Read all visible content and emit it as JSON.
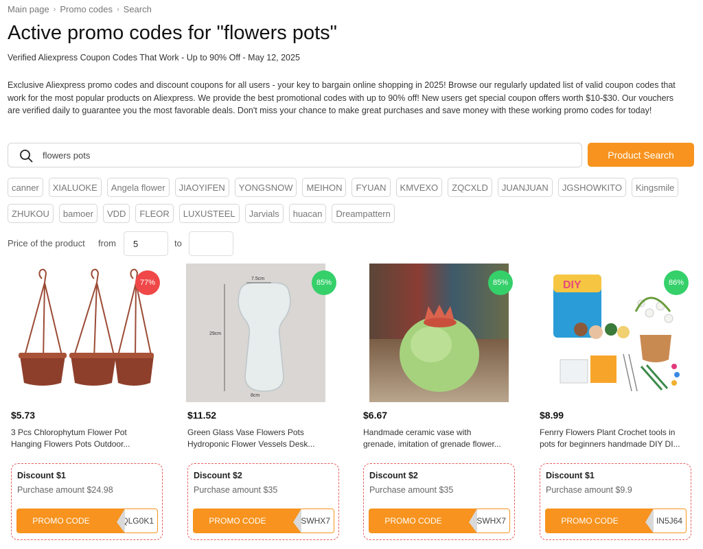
{
  "breadcrumb": [
    "Main page",
    "Promo codes",
    "Search"
  ],
  "title": "Active promo codes for \"flowers pots\"",
  "subtitle": "Verified Aliexpress Coupon Codes That Work - Up to 90% Off - May 12, 2025",
  "intro": "Exclusive Aliexpress promo codes and discount coupons for all users - your key to bargain online shopping in 2025! Browse our regularly updated list of valid coupon codes that work for the most popular products on Aliexpress. We provide the best promotional codes with up to 90% off! New users get special coupon offers worth $10-$30. Our vouchers are verified daily to guarantee you the most favorable deals. Don't miss your chance to make great purchases and save money with these working promo codes for today!",
  "search": {
    "value": "flowers pots",
    "button": "Product Search",
    "icon": "search-icon"
  },
  "tags": [
    "canner",
    "XIALUOKE",
    "Angela flower",
    "JIAOYIFEN",
    "YONGSNOW",
    "MEIHON",
    "FYUAN",
    "KMVEXO",
    "ZQCXLD",
    "JUANJUAN",
    "JGSHOWKITO",
    "Kingsmile",
    "ZHUKOU",
    "bamoer",
    "VDD",
    "FLEOR",
    "LUXUSTEEL",
    "Jarvials",
    "huacan",
    "Dreampattern"
  ],
  "price_filter": {
    "label": "Price of the product",
    "from_label": "from",
    "to_label": "to",
    "from_value": "5",
    "to_value": ""
  },
  "colors": {
    "accent": "#f7931e",
    "badge_red": "#f04848",
    "badge_green": "#35d06a",
    "coupon_border": "#e85a5a"
  },
  "products": [
    {
      "badge": "77%",
      "badge_color": "#f04848",
      "price": "$5.73",
      "title_line1": "3 Pcs Chlorophytum Flower Pot",
      "title_line2": "Hanging Flowers Pots Outdoor...",
      "discount": "Discount $1",
      "purchase": "Purchase amount $24.98",
      "promo_label": "PROMO CODE",
      "code_fragment": "QLG0K1"
    },
    {
      "badge": "85%",
      "badge_color": "#35d06a",
      "price": "$11.52",
      "title_line1": "Green Glass Vase Flowers Pots",
      "title_line2": "Hydroponic Flower Vessels Desk...",
      "discount": "Discount $2",
      "purchase": "Purchase amount $35",
      "promo_label": "PROMO CODE",
      "code_fragment": "SWHX7",
      "image_text": {
        "dim_top": "7.5cm",
        "dim_side": "29cm",
        "dim_bottom": "8cm"
      }
    },
    {
      "badge": "85%",
      "badge_color": "#35d06a",
      "price": "$6.67",
      "title_line1": "Handmade ceramic vase with",
      "title_line2": "grenade, imitation of grenade flower...",
      "discount": "Discount $2",
      "purchase": "Purchase amount $35",
      "promo_label": "PROMO CODE",
      "code_fragment": "SWHX7"
    },
    {
      "badge": "86%",
      "badge_color": "#35d06a",
      "price": "$8.99",
      "title_line1": "Fenrry Flowers Plant Crochet tools in",
      "title_line2": "pots for beginners handmade DIY DI...",
      "discount": "Discount $1",
      "purchase": "Purchase amount $9.9",
      "promo_label": "PROMO CODE",
      "code_fragment": "IN5J64",
      "image_text": {
        "brand": "DIY"
      }
    }
  ]
}
